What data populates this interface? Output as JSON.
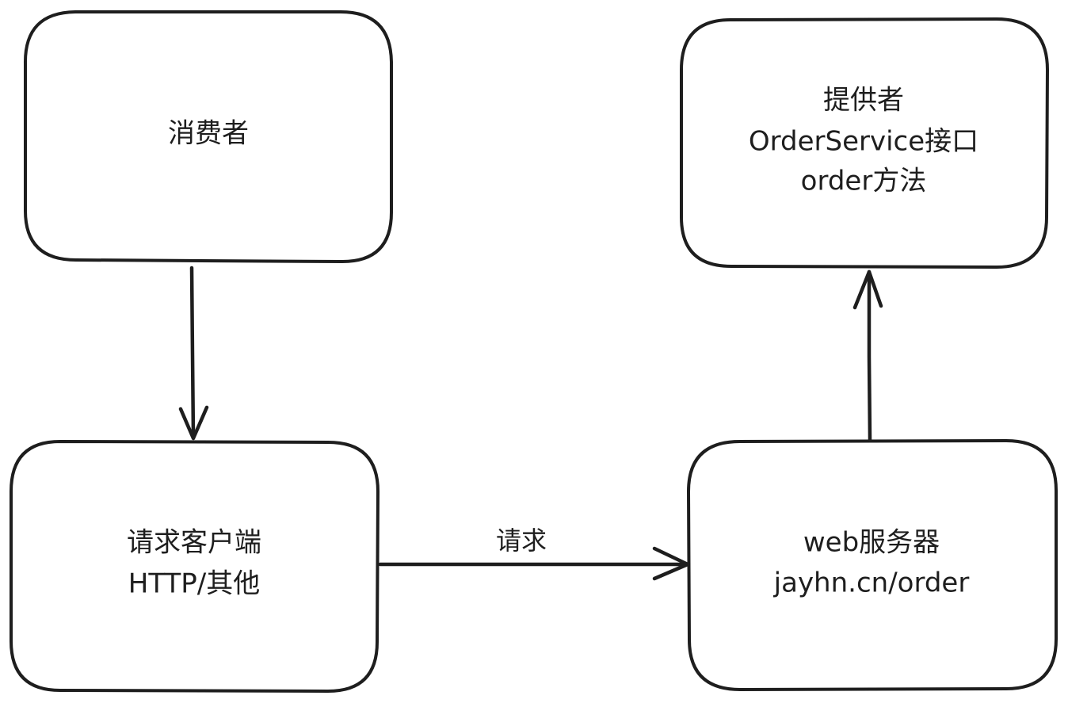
{
  "nodes": {
    "consumer": {
      "lines": [
        "消费者"
      ]
    },
    "request_client": {
      "lines": [
        "请求客户端",
        "HTTP/其他"
      ]
    },
    "web_server": {
      "lines": [
        "web服务器",
        "jayhn.cn/order"
      ]
    },
    "provider": {
      "lines": [
        "提供者",
        "OrderService接口",
        "order方法"
      ]
    }
  },
  "edges": {
    "client_to_server": {
      "label": "请求"
    }
  },
  "colors": {
    "stroke": "#1e1e1e",
    "fill": "#ffffff",
    "background": "#ffffff"
  }
}
